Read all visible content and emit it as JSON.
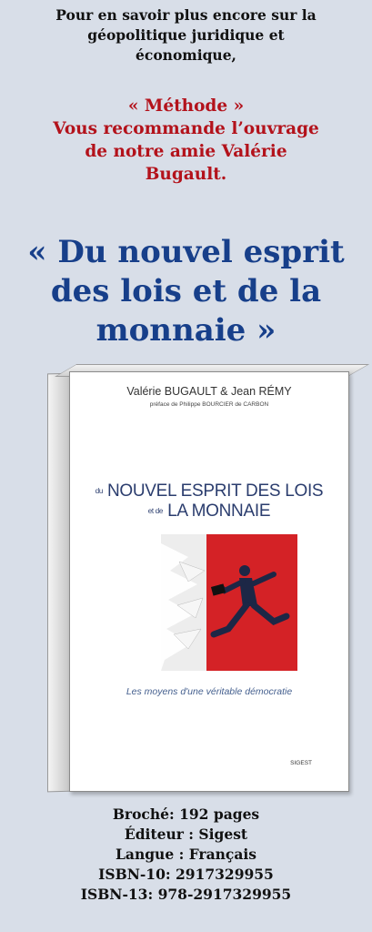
{
  "intro": {
    "line1": "Pour en savoir plus encore sur la",
    "line2": "géopolitique juridique et",
    "line3": "économique,"
  },
  "recommend": {
    "line1": "« Méthode »",
    "line2": "Vous recommande l’ouvrage",
    "line3": "de notre amie Valérie",
    "line4": "Bugault."
  },
  "title": {
    "line1": "« Du nouvel esprit",
    "line2": "des lois et de la",
    "line3": "monnaie »"
  },
  "cover": {
    "authors": "Valérie BUGAULT & Jean RÉMY",
    "preface": "préface de Philippe BOURCIER de CARBON",
    "title_small1": "du",
    "title_main1": "NOUVEL ESPRIT DES LOIS",
    "title_small2": "et de",
    "title_main2": "LA MONNAIE",
    "subtitle": "Les moyens d'une véritable démocratie",
    "publisher": "SIGEST"
  },
  "details": {
    "format": "Broché: 192 pages",
    "editor": "Éditeur : Sigest",
    "language": "Langue : Français",
    "isbn10": "ISBN-10: 2917329955",
    "isbn13": "ISBN-13: 978-2917329955"
  },
  "colors": {
    "background": "#d8dee8",
    "recommend": "#b3121b",
    "title": "#173f8a",
    "cover_red": "#d42226"
  }
}
